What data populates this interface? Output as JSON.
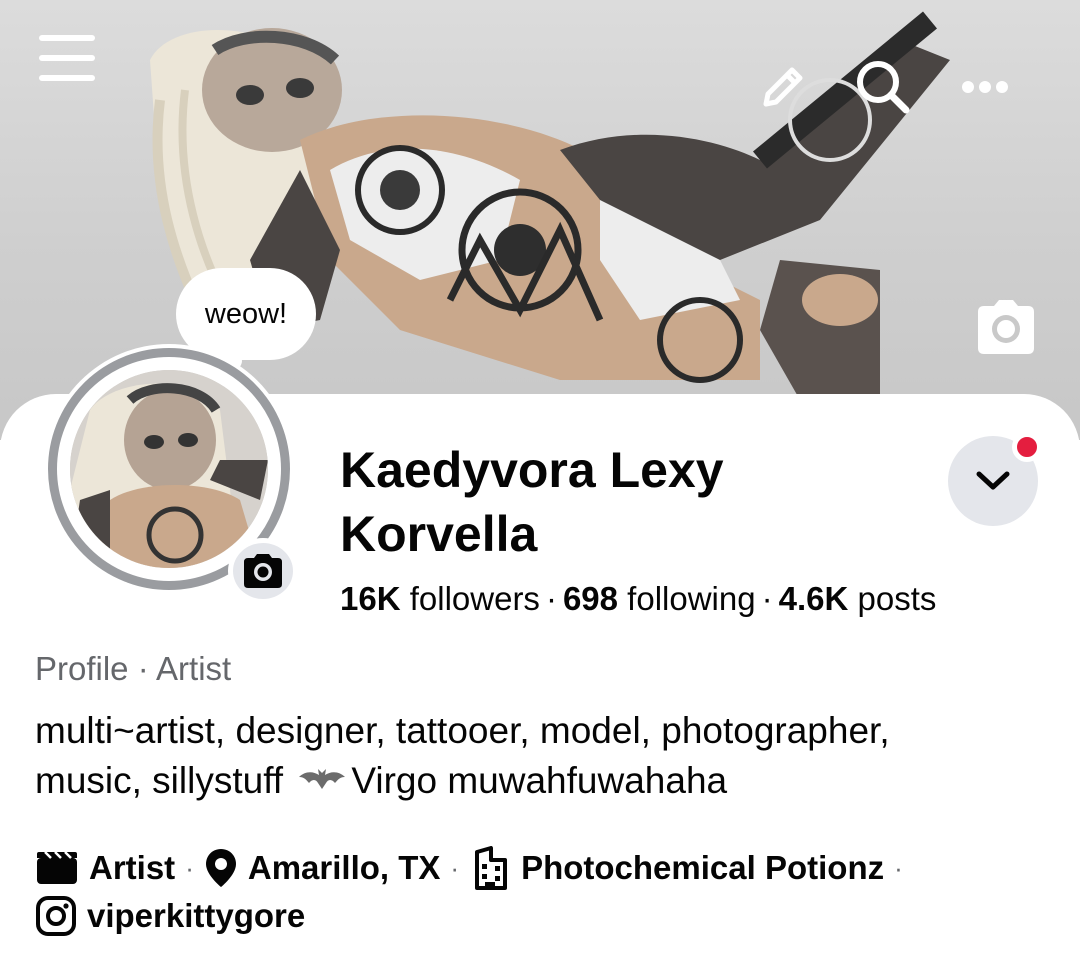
{
  "cover": {
    "icons": {
      "menu": "hamburger-menu-icon",
      "edit": "pencil-icon",
      "search": "search-icon",
      "more": "more-dots-icon",
      "camera": "camera-icon"
    }
  },
  "bubble": {
    "text": "weow!"
  },
  "profile": {
    "name": "Kaedyvora Lexy Korvella",
    "stats": {
      "followers_count": "16K",
      "followers_label": "followers",
      "following_count": "698",
      "following_label": "following",
      "posts_count": "4.6K",
      "posts_label": "posts",
      "separator": "·"
    },
    "category": "Profile · Artist",
    "bio": {
      "line1": "multi~artist, designer, tattooer, model, photographer,",
      "line2_before": "music, sillystuff",
      "line2_after": "Virgo muwahfuwahaha"
    }
  },
  "details": {
    "separator": "·",
    "job": "Artist",
    "location": "Amarillo, TX",
    "workplace": "Photochemical Potionz",
    "instagram": "viperkittygore"
  },
  "colors": {
    "accent_red": "#e41e3f",
    "muted_text": "#65676b",
    "button_bg": "#e4e6eb",
    "ring": "#9a9ca0"
  }
}
